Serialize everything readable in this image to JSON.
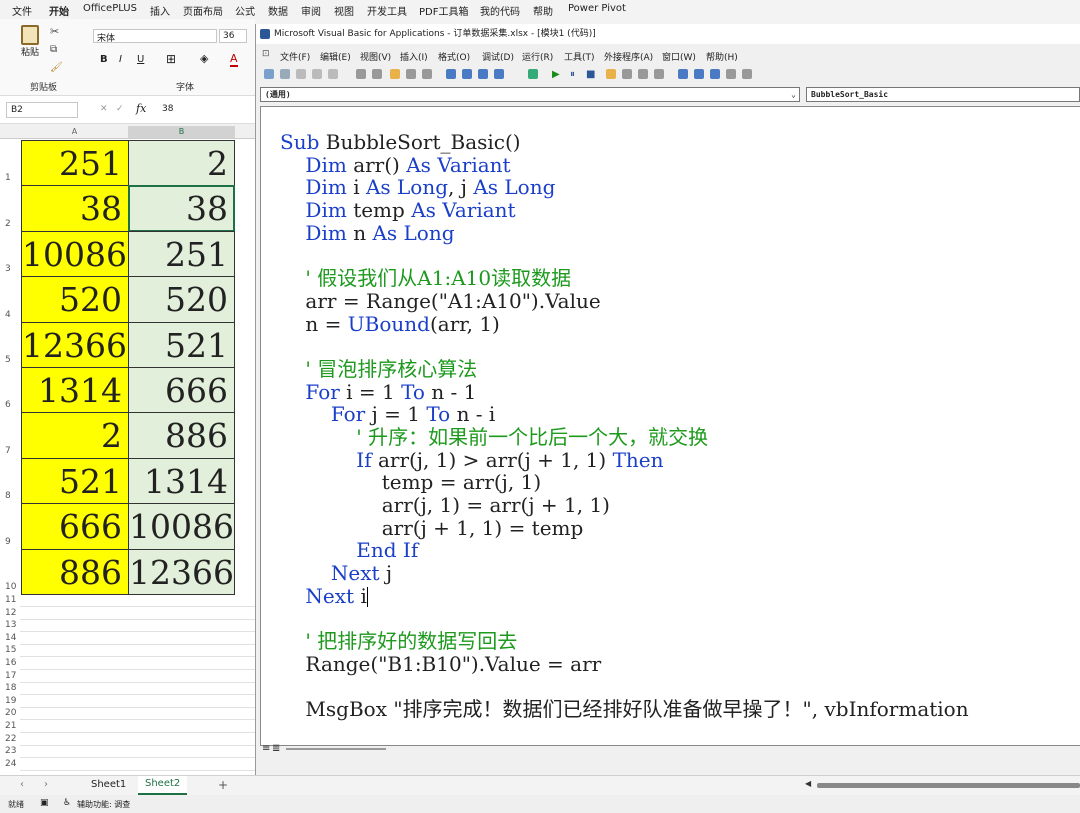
{
  "excel": {
    "menu_tabs": [
      "文件",
      "开始",
      "OfficePLUS",
      "插入",
      "页面布局",
      "公式",
      "数据",
      "审阅",
      "视图",
      "开发工具",
      "PDF工具箱",
      "我的代码",
      "帮助",
      "Power Pivot"
    ],
    "active_tab": "开始",
    "ribbon": {
      "paste_label": "粘贴",
      "clipboard_group": "剪贴板",
      "font_name": "宋体",
      "font_size": "36",
      "font_group": "字体",
      "bold": "B",
      "italic": "I",
      "underline": "U",
      "font_color_letter": "A"
    },
    "name_box": "B2",
    "fx_label": "fx",
    "formula_value": "38",
    "col_headers": [
      "A",
      "B"
    ],
    "rows": [
      {
        "num": "1",
        "a": "251",
        "b": "2"
      },
      {
        "num": "2",
        "a": "38",
        "b": "38"
      },
      {
        "num": "3",
        "a": "10086",
        "b": "251"
      },
      {
        "num": "4",
        "a": "520",
        "b": "520"
      },
      {
        "num": "5",
        "a": "12366",
        "b": "521"
      },
      {
        "num": "6",
        "a": "1314",
        "b": "666"
      },
      {
        "num": "7",
        "a": "2",
        "b": "886"
      },
      {
        "num": "8",
        "a": "521",
        "b": "1314"
      },
      {
        "num": "9",
        "a": "666",
        "b": "10086"
      },
      {
        "num": "10",
        "a": "886",
        "b": "12366"
      }
    ],
    "empty_rows": [
      "11",
      "12",
      "13",
      "14",
      "15",
      "16",
      "17",
      "18",
      "19",
      "20",
      "21",
      "22",
      "23",
      "24"
    ],
    "sheets": [
      "Sheet1",
      "Sheet2"
    ],
    "active_sheet": "Sheet2",
    "add_sheet": "+",
    "status_ready": "就绪",
    "status_accessibility": "辅助功能: 调查",
    "colors": {
      "yellow": "#ffff00",
      "green": "#e2efda",
      "accent": "#1e7145"
    }
  },
  "vbe": {
    "title": "Microsoft Visual Basic for Applications - 订单数据采集.xlsx - [模块1 (代码)]",
    "menu": [
      "文件(F)",
      "编辑(E)",
      "视图(V)",
      "插入(I)",
      "格式(O)",
      "调试(D)",
      "运行(R)",
      "工具(T)",
      "外接程序(A)",
      "窗口(W)",
      "帮助(H)"
    ],
    "object_combo": "(通用)",
    "proc_combo": "BubbleSort_Basic",
    "code": [
      [
        {
          "t": "Sub ",
          "c": "kw"
        },
        {
          "t": "BubbleSort_Basic()",
          "c": "tx"
        }
      ],
      [
        {
          "t": "    Dim ",
          "c": "kw"
        },
        {
          "t": "arr() ",
          "c": "tx"
        },
        {
          "t": "As Variant",
          "c": "kw"
        }
      ],
      [
        {
          "t": "    Dim ",
          "c": "kw"
        },
        {
          "t": "i ",
          "c": "tx"
        },
        {
          "t": "As Long",
          "c": "kw"
        },
        {
          "t": ", j ",
          "c": "tx"
        },
        {
          "t": "As Long",
          "c": "kw"
        }
      ],
      [
        {
          "t": "    Dim ",
          "c": "kw"
        },
        {
          "t": "temp ",
          "c": "tx"
        },
        {
          "t": "As Variant",
          "c": "kw"
        }
      ],
      [
        {
          "t": "    Dim ",
          "c": "kw"
        },
        {
          "t": "n ",
          "c": "tx"
        },
        {
          "t": "As Long",
          "c": "kw"
        }
      ],
      [
        {
          "t": "",
          "c": "tx"
        }
      ],
      [
        {
          "t": "    ' 假设我们从A1:A10读取数据",
          "c": "cm"
        }
      ],
      [
        {
          "t": "    arr = Range(\"A1:A10\").Value",
          "c": "tx"
        }
      ],
      [
        {
          "t": "    n = ",
          "c": "tx"
        },
        {
          "t": "UBound",
          "c": "kw"
        },
        {
          "t": "(arr, 1)",
          "c": "tx"
        }
      ],
      [
        {
          "t": "",
          "c": "tx"
        }
      ],
      [
        {
          "t": "    ' 冒泡排序核心算法",
          "c": "cm"
        }
      ],
      [
        {
          "t": "    For ",
          "c": "kw"
        },
        {
          "t": "i = 1 ",
          "c": "tx"
        },
        {
          "t": "To ",
          "c": "kw"
        },
        {
          "t": "n - 1",
          "c": "tx"
        }
      ],
      [
        {
          "t": "        For ",
          "c": "kw"
        },
        {
          "t": "j = 1 ",
          "c": "tx"
        },
        {
          "t": "To ",
          "c": "kw"
        },
        {
          "t": "n - i",
          "c": "tx"
        }
      ],
      [
        {
          "t": "            ' 升序：如果前一个比后一个大，就交换",
          "c": "cm"
        }
      ],
      [
        {
          "t": "            If ",
          "c": "kw"
        },
        {
          "t": "arr(j, 1) > arr(j + 1, 1) ",
          "c": "tx"
        },
        {
          "t": "Then",
          "c": "kw"
        }
      ],
      [
        {
          "t": "                temp = arr(j, 1)",
          "c": "tx"
        }
      ],
      [
        {
          "t": "                arr(j, 1) = arr(j + 1, 1)",
          "c": "tx"
        }
      ],
      [
        {
          "t": "                arr(j + 1, 1) = temp",
          "c": "tx"
        }
      ],
      [
        {
          "t": "            End If",
          "c": "kw"
        }
      ],
      [
        {
          "t": "        Next ",
          "c": "kw"
        },
        {
          "t": "j",
          "c": "tx"
        }
      ],
      [
        {
          "t": "    Next ",
          "c": "kw"
        },
        {
          "t": "i",
          "c": "tx"
        }
      ],
      [
        {
          "t": "",
          "c": "tx"
        }
      ],
      [
        {
          "t": "    ' 把排序好的数据写回去",
          "c": "cm"
        }
      ],
      [
        {
          "t": "    Range(\"B1:B10\").Value = arr",
          "c": "tx"
        }
      ],
      [
        {
          "t": "",
          "c": "tx"
        }
      ],
      [
        {
          "t": "    MsgBox \"排序完成！数据们已经排好队准备做早操了！\", vbInformation",
          "c": "tx"
        }
      ]
    ]
  }
}
